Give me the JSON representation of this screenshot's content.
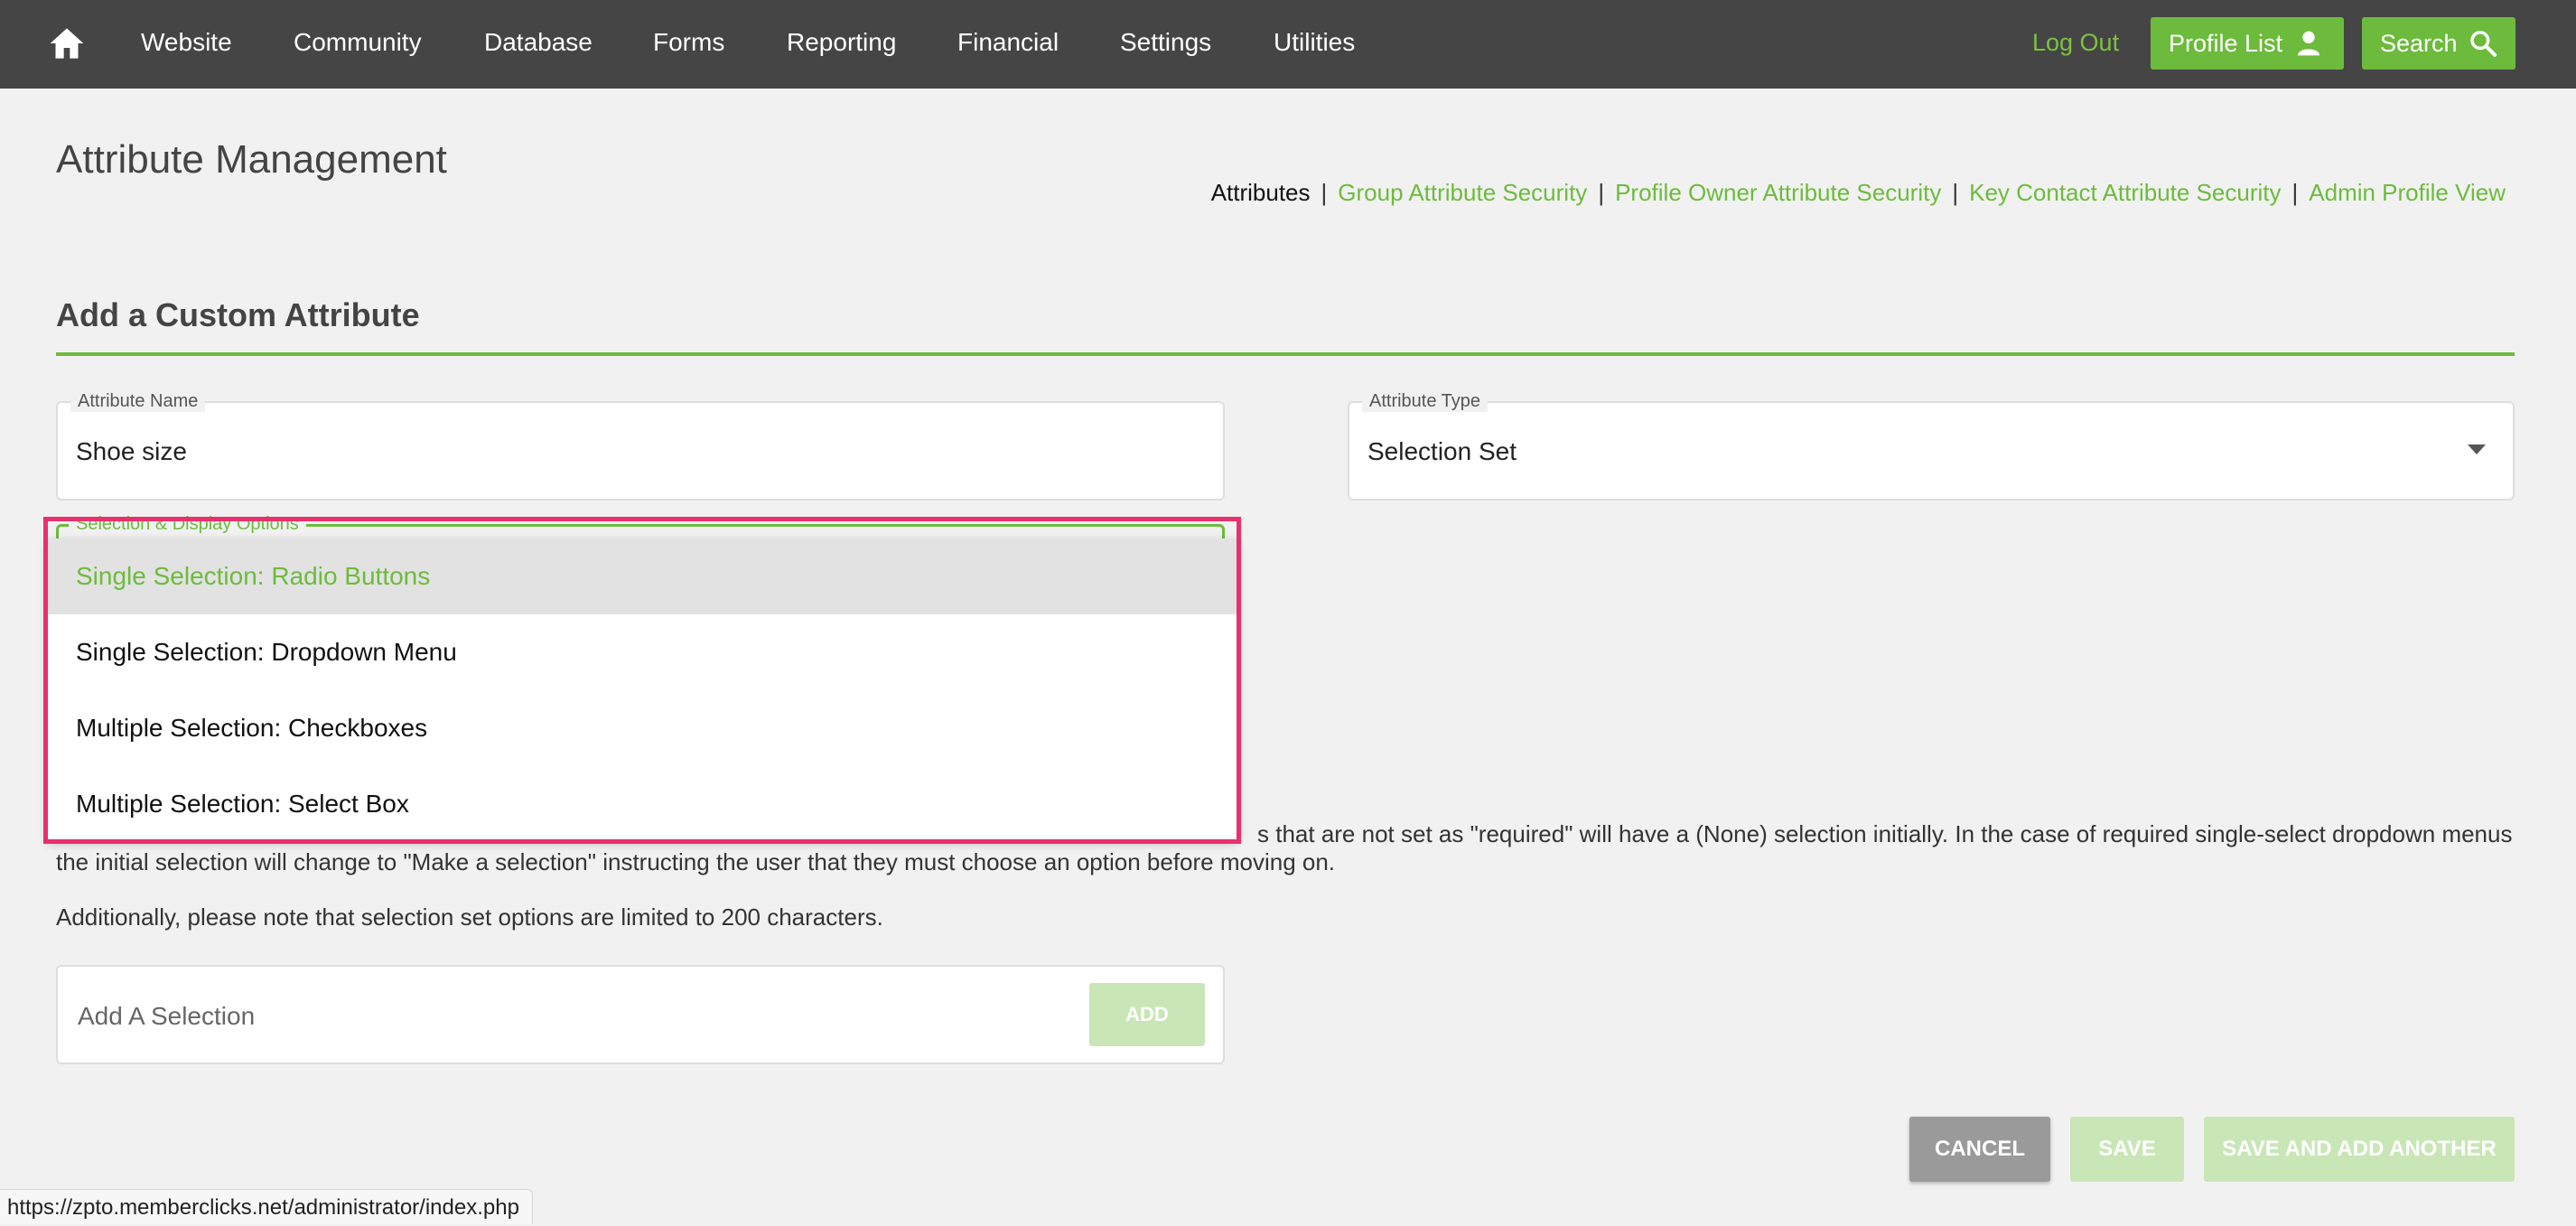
{
  "nav": {
    "items": [
      {
        "label": "Website"
      },
      {
        "label": "Community"
      },
      {
        "label": "Database"
      },
      {
        "label": "Forms"
      },
      {
        "label": "Reporting"
      },
      {
        "label": "Financial"
      },
      {
        "label": "Settings"
      },
      {
        "label": "Utilities"
      }
    ],
    "logout_label": "Log Out",
    "profile_list_label": "Profile List",
    "search_label": "Search"
  },
  "page": {
    "title": "Attribute Management",
    "sublinks": [
      {
        "label": "Attributes"
      },
      {
        "label": "Group Attribute Security"
      },
      {
        "label": "Profile Owner Attribute Security"
      },
      {
        "label": "Key Contact Attribute Security"
      },
      {
        "label": "Admin Profile View"
      }
    ],
    "section_title": "Add a Custom Attribute"
  },
  "form": {
    "attribute_name": {
      "label": "Attribute Name",
      "value": "Shoe size"
    },
    "attribute_type": {
      "label": "Attribute Type",
      "value": "Selection Set"
    },
    "selection_display": {
      "label": "Selection & Display Options",
      "options": [
        {
          "label": "Single Selection: Radio Buttons"
        },
        {
          "label": "Single Selection: Dropdown Menu"
        },
        {
          "label": "Multiple Selection: Checkboxes"
        },
        {
          "label": "Multiple Selection: Select Box"
        }
      ]
    },
    "help_text": "s that are not set as \"required\" will have a (None) selection initially. In the case of required single-select dropdown menus the initial selection will change to \"Make a selection\" instructing the user that they must choose an option before moving on.",
    "help_text_2": "Additionally, please note that selection set options are limited to 200 characters.",
    "add_selection": {
      "placeholder": "Add A Selection",
      "button_label": "ADD"
    }
  },
  "actions": {
    "cancel_label": "CANCEL",
    "save_label": "SAVE",
    "save_add_label": "SAVE AND ADD ANOTHER"
  },
  "status_url": "https://zpto.memberclicks.net/administrator/index.php",
  "colors": {
    "brand_green": "#6dbb3c",
    "nav_bg": "#454545",
    "highlight": "#e8306d"
  }
}
